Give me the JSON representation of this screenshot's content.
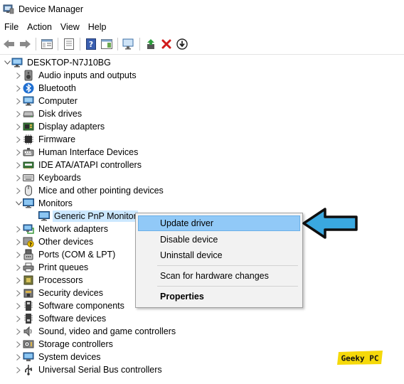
{
  "window": {
    "title": "Device Manager"
  },
  "menu": [
    "File",
    "Action",
    "View",
    "Help"
  ],
  "tree": {
    "root": "DESKTOP-N7J10BG",
    "items": [
      {
        "label": "Audio inputs and outputs",
        "icon": "speaker-icon"
      },
      {
        "label": "Bluetooth",
        "icon": "bluetooth-icon"
      },
      {
        "label": "Computer",
        "icon": "computer-icon"
      },
      {
        "label": "Disk drives",
        "icon": "disk-drive-icon"
      },
      {
        "label": "Display adapters",
        "icon": "display-adapter-icon"
      },
      {
        "label": "Firmware",
        "icon": "firmware-chip-icon"
      },
      {
        "label": "Human Interface Devices",
        "icon": "hid-icon"
      },
      {
        "label": "IDE ATA/ATAPI controllers",
        "icon": "ide-controller-icon"
      },
      {
        "label": "Keyboards",
        "icon": "keyboard-icon"
      },
      {
        "label": "Mice and other pointing devices",
        "icon": "mouse-icon"
      },
      {
        "label": "Monitors",
        "icon": "monitor-icon",
        "expanded": true
      },
      {
        "label": "Generic PnP Monitor",
        "icon": "monitor-icon",
        "child": true,
        "selected": true
      },
      {
        "label": "Network adapters",
        "icon": "network-icon"
      },
      {
        "label": "Other devices",
        "icon": "other-devices-icon"
      },
      {
        "label": "Ports (COM & LPT)",
        "icon": "port-icon"
      },
      {
        "label": "Print queues",
        "icon": "printer-icon"
      },
      {
        "label": "Processors",
        "icon": "processor-icon"
      },
      {
        "label": "Security devices",
        "icon": "security-icon"
      },
      {
        "label": "Software components",
        "icon": "software-component-icon"
      },
      {
        "label": "Software devices",
        "icon": "software-device-icon"
      },
      {
        "label": "Sound, video and game controllers",
        "icon": "sound-icon"
      },
      {
        "label": "Storage controllers",
        "icon": "storage-icon"
      },
      {
        "label": "System devices",
        "icon": "system-devices-icon"
      },
      {
        "label": "Universal Serial Bus controllers",
        "icon": "usb-icon"
      }
    ]
  },
  "context_menu": {
    "update_driver": "Update driver",
    "disable_device": "Disable device",
    "uninstall_device": "Uninstall device",
    "scan_hardware": "Scan for hardware changes",
    "properties": "Properties"
  },
  "watermark": "Geeky PC",
  "colors": {
    "selection": "#cce8ff",
    "menu_highlight": "#91c9f7",
    "arrow": "#3aa8e0",
    "watermark_bg": "#f5d90a"
  }
}
